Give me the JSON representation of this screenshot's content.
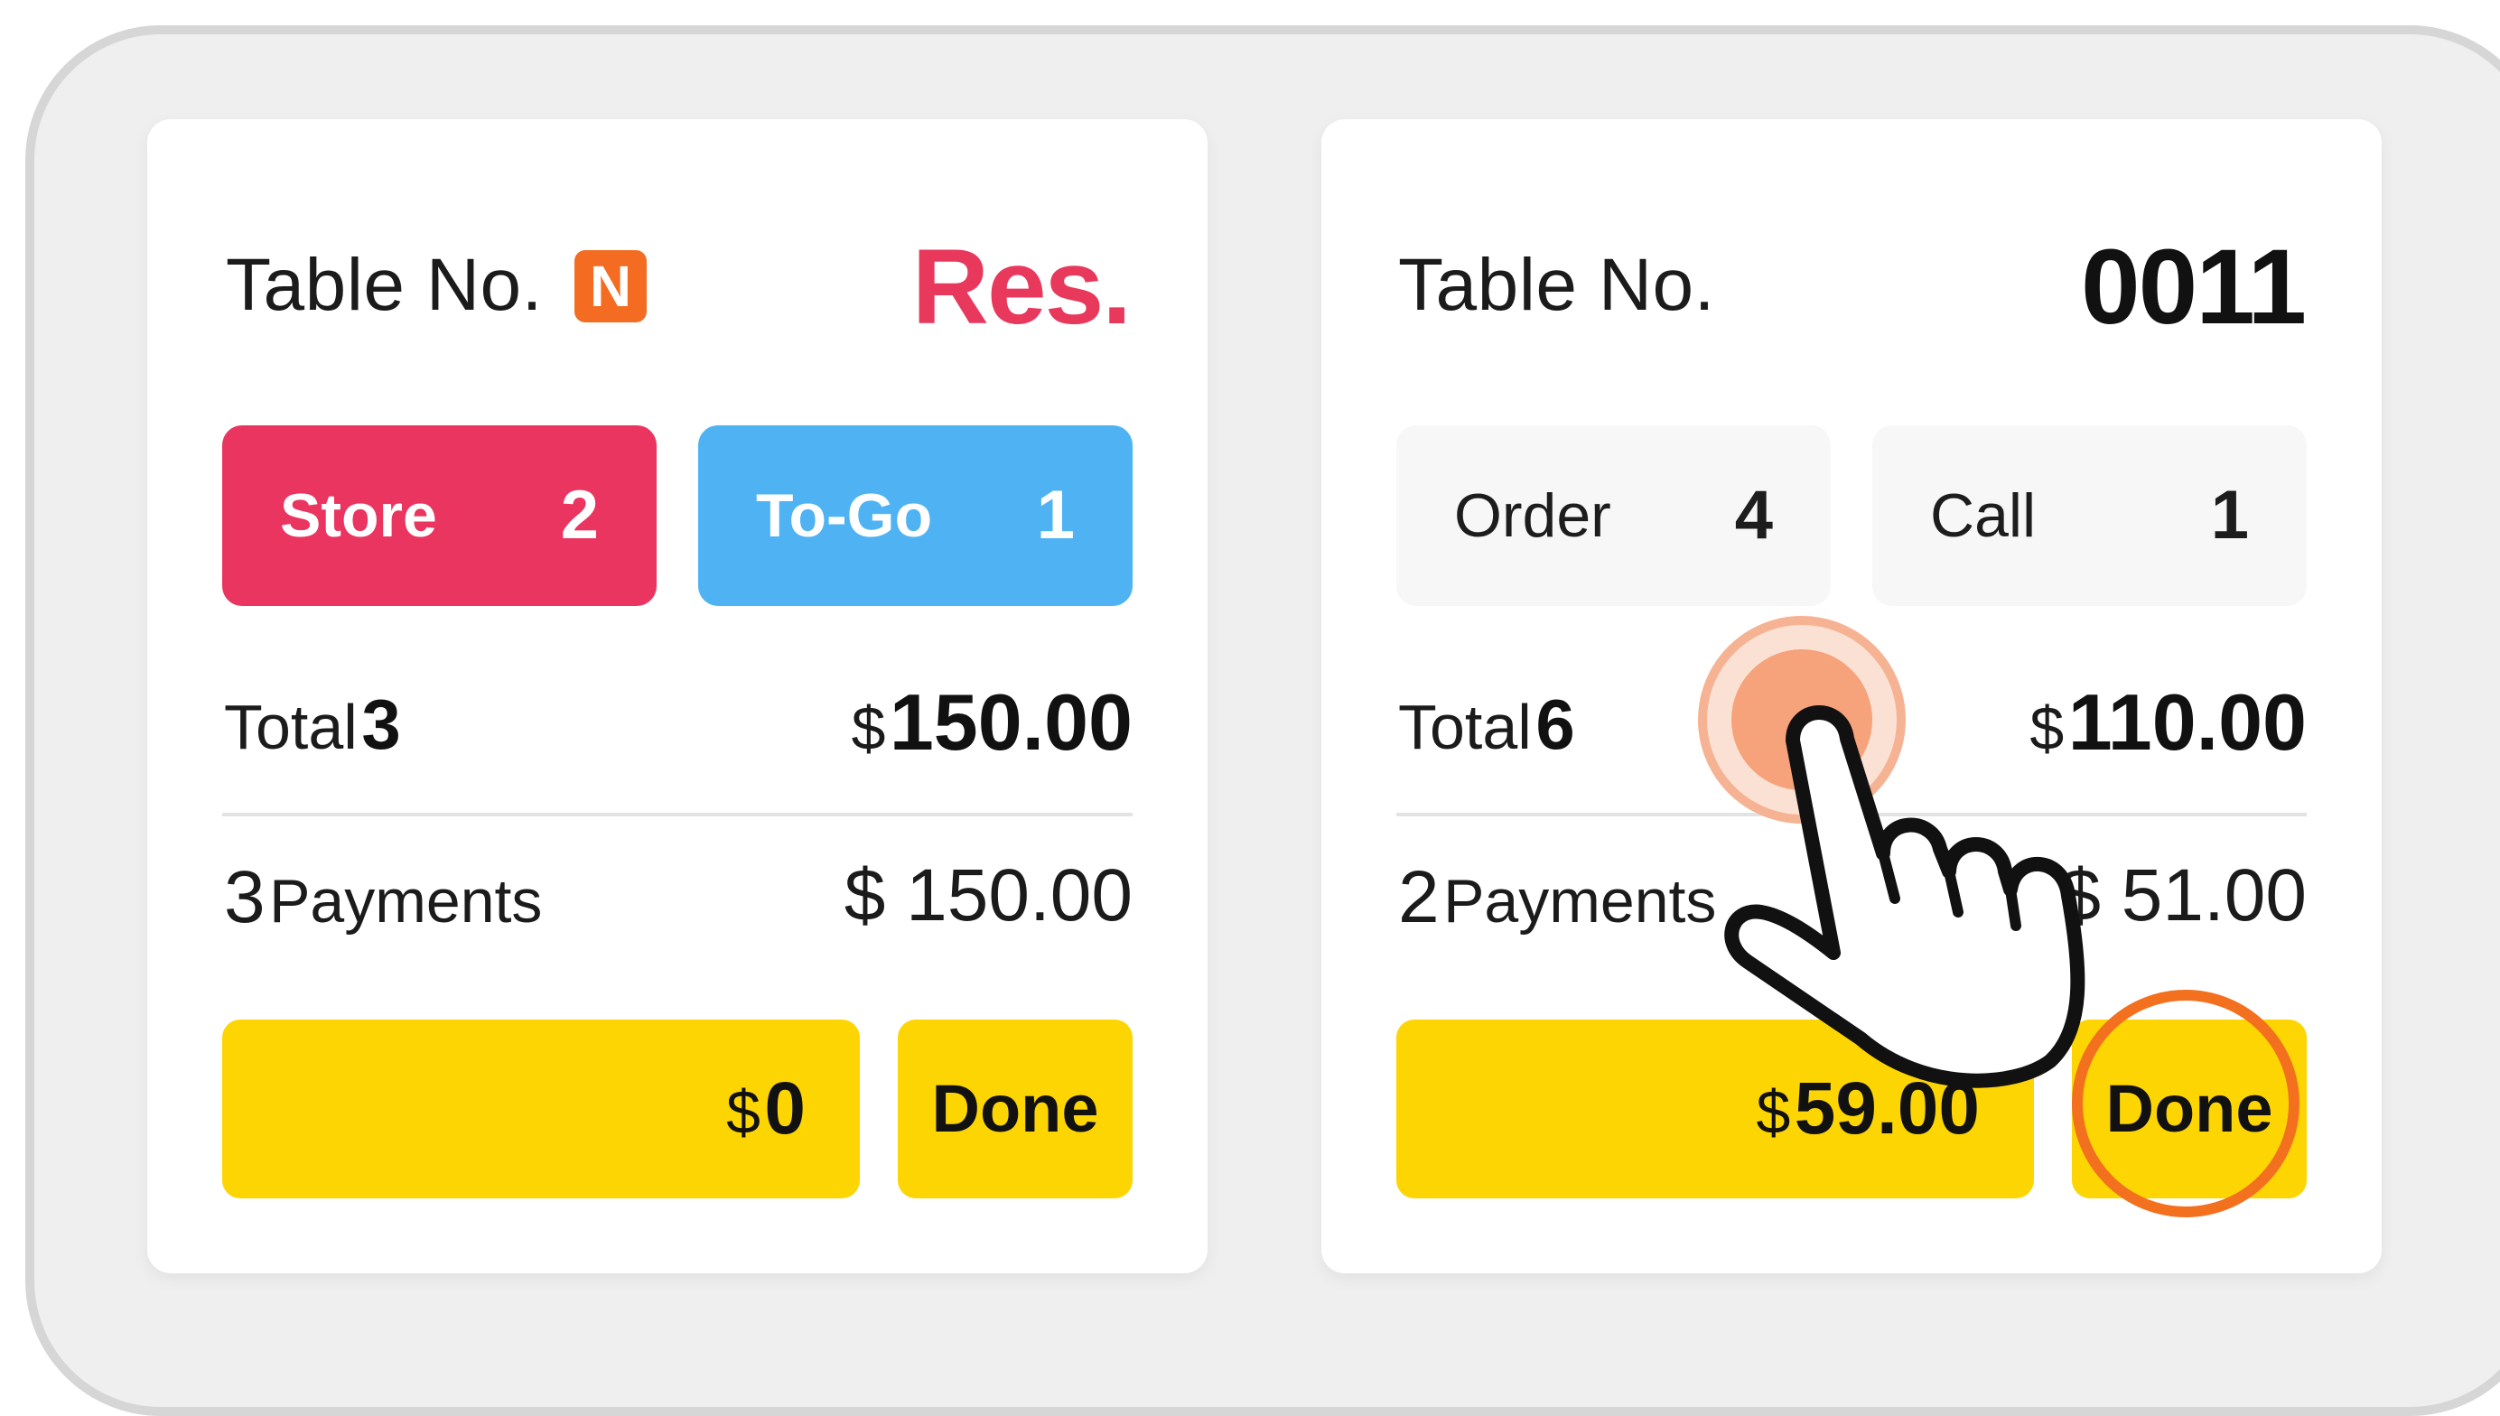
{
  "cards": [
    {
      "table_label": "Table No.",
      "badge": "N",
      "status": "Res.",
      "tiles": [
        {
          "label": "Store",
          "count": "2"
        },
        {
          "label": "To-Go",
          "count": "1"
        }
      ],
      "total_label": "Total",
      "total_count": "3",
      "total_currency": "$",
      "total_amount": "150.00",
      "payments_count": "3",
      "payments_label": "Payments",
      "payments_amount": "$ 150.00",
      "due_currency": "$",
      "due_amount": "0",
      "done_label": "Done"
    },
    {
      "table_label": "Table No.",
      "table_number": "0011",
      "tiles": [
        {
          "label": "Order",
          "count": "4"
        },
        {
          "label": "Call",
          "count": "1"
        }
      ],
      "total_label": "Total",
      "total_count": "6",
      "total_currency": "$",
      "total_amount": "110.00",
      "payments_count": "2",
      "payments_label": "Payments",
      "payments_amount": "$ 51.00",
      "due_currency": "$",
      "due_amount": "59.00",
      "done_label": "Done"
    }
  ],
  "colors": {
    "store": "#ea3560",
    "togo": "#4fb3f3",
    "badge": "#f36c21",
    "res": "#e8385c",
    "done": "#fdd503",
    "tap_highlight": "#f6a27a",
    "ring": "#f2701e"
  },
  "icons": [
    "tap-hand-icon",
    "tap-ripple-icon",
    "highlight-ring-icon"
  ]
}
